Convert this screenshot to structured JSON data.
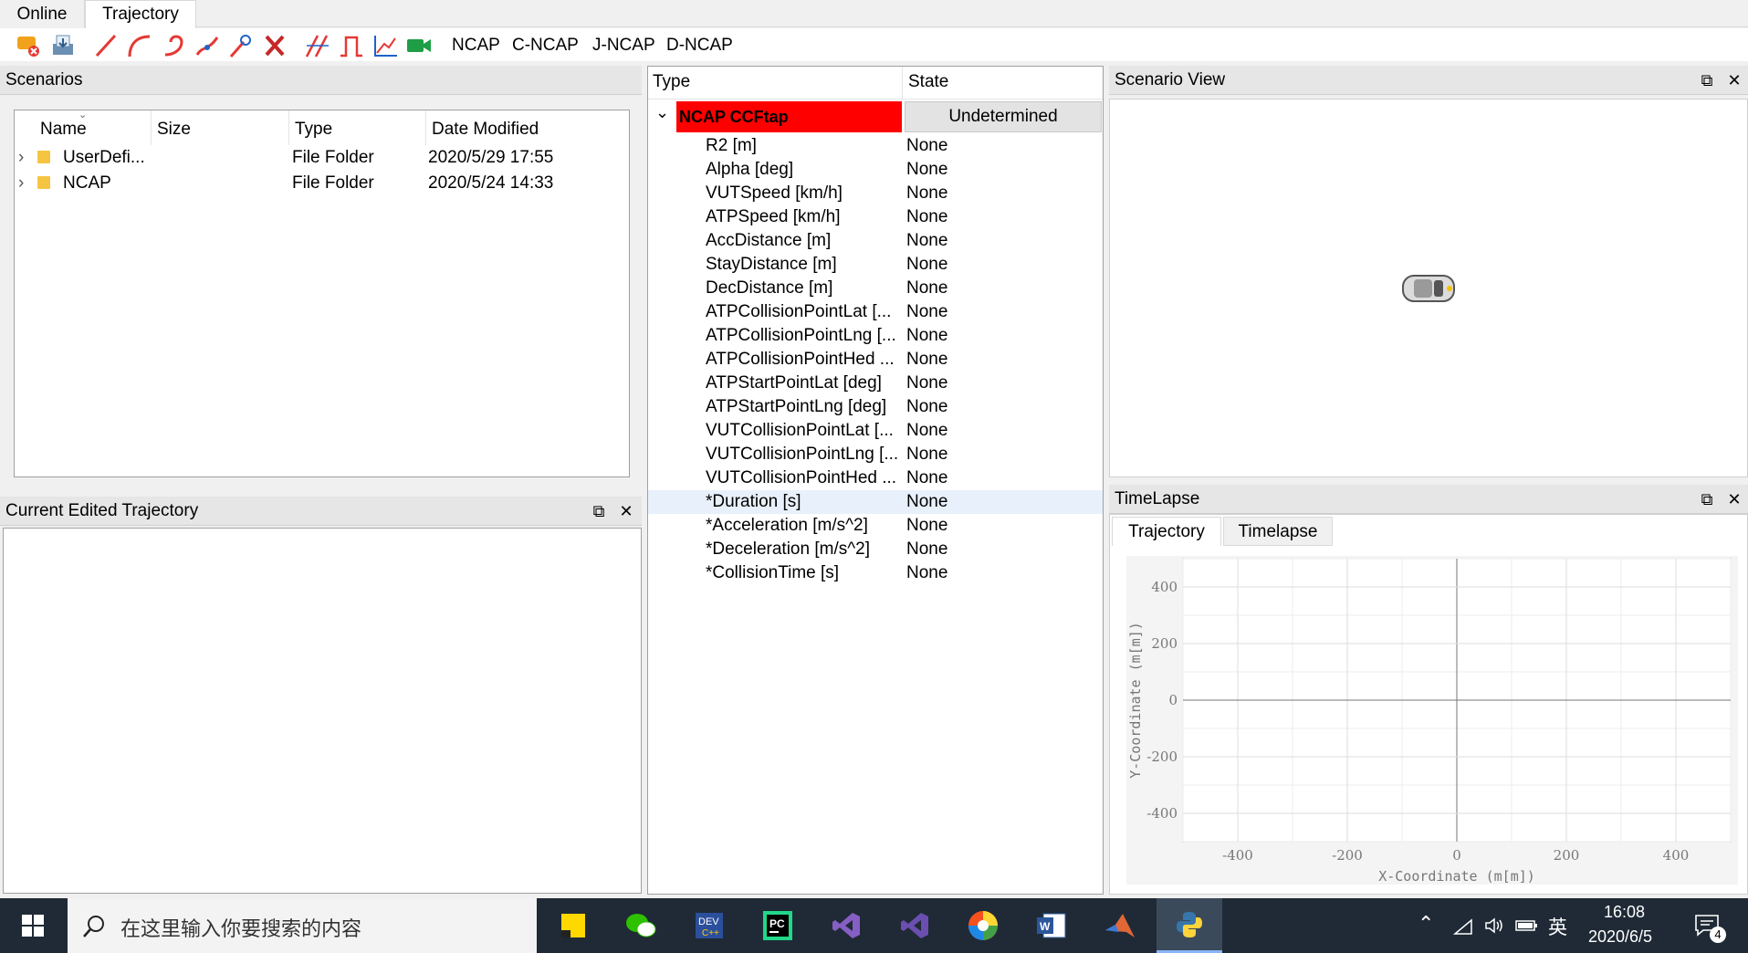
{
  "tabs": [
    {
      "label": "Online",
      "active": false
    },
    {
      "label": "Trajectory",
      "active": true
    }
  ],
  "toolbar": {
    "icons": [
      "delete-scenario-icon",
      "import-icon",
      "line-icon",
      "arc-icon",
      "loop-curve-icon",
      "spline-icon",
      "point-marker-icon",
      "clear-icon",
      "parallel-lines-icon",
      "pulse-icon",
      "axis-plot-icon",
      "camera-icon"
    ],
    "ncap_buttons": [
      "NCAP",
      "C-NCAP",
      "J-NCAP",
      "D-NCAP"
    ]
  },
  "scenarios": {
    "title": "Scenarios",
    "columns": [
      "Name",
      "Size",
      "Type",
      "Date Modified"
    ],
    "rows": [
      {
        "name": "UserDefi...",
        "size": "",
        "type": "File Folder",
        "date": "2020/5/29 17:55"
      },
      {
        "name": "NCAP",
        "size": "",
        "type": "File Folder",
        "date": "2020/5/24 14:33"
      }
    ]
  },
  "edited_trajectory": {
    "title": "Current Edited Trajectory"
  },
  "properties": {
    "col_type": "Type",
    "col_state": "State",
    "group_name": "NCAP CCFtap",
    "group_state": "Undetermined",
    "rows": [
      {
        "name": "R2 [m]",
        "value": "None"
      },
      {
        "name": "Alpha [deg]",
        "value": "None"
      },
      {
        "name": "VUTSpeed [km/h]",
        "value": "None"
      },
      {
        "name": "ATPSpeed [km/h]",
        "value": "None"
      },
      {
        "name": "AccDistance [m]",
        "value": "None"
      },
      {
        "name": "StayDistance [m]",
        "value": "None"
      },
      {
        "name": "DecDistance [m]",
        "value": "None"
      },
      {
        "name": "ATPCollisionPointLat [...",
        "value": "None"
      },
      {
        "name": "ATPCollisionPointLng [...",
        "value": "None"
      },
      {
        "name": "ATPCollisionPointHed ...",
        "value": "None"
      },
      {
        "name": "ATPStartPointLat [deg]",
        "value": "None"
      },
      {
        "name": "ATPStartPointLng [deg]",
        "value": "None"
      },
      {
        "name": "VUTCollisionPointLat [...",
        "value": "None"
      },
      {
        "name": "VUTCollisionPointLng [...",
        "value": "None"
      },
      {
        "name": "VUTCollisionPointHed ...",
        "value": "None"
      },
      {
        "name": "*Duration [s]",
        "value": "None"
      },
      {
        "name": "*Acceleration [m/s^2]",
        "value": "None"
      },
      {
        "name": "*Deceleration [m/s^2]",
        "value": "None"
      },
      {
        "name": "*CollisionTime [s]",
        "value": "None"
      }
    ]
  },
  "scenario_view": {
    "title": "Scenario View"
  },
  "timelapse": {
    "title": "TimeLapse",
    "tabs": [
      "Trajectory",
      "Timelapse"
    ],
    "active_tab": "Trajectory"
  },
  "chart_data": {
    "type": "line",
    "xlabel": "X-Coordinate (m[m])",
    "ylabel": "Y-Coordinate (m[m])",
    "xlim": [
      -500,
      500
    ],
    "ylim": [
      -500,
      500
    ],
    "xticks": [
      -400,
      -200,
      0,
      200,
      400
    ],
    "yticks": [
      400,
      200,
      0,
      -200,
      -400
    ],
    "series": [],
    "grid": true
  },
  "taskbar": {
    "search_placeholder": "在这里输入你要搜索的内容",
    "apps": [
      "sticky-notes-icon",
      "wechat-icon",
      "devcpp-icon",
      "pycharm-icon",
      "visual-studio-icon",
      "visual-studio-2-icon",
      "chrome-like-icon",
      "word-icon",
      "matlab-icon",
      "python-app-icon"
    ],
    "ime": "英",
    "time": "16:08",
    "date": "2020/6/5",
    "notification_count": "4"
  }
}
